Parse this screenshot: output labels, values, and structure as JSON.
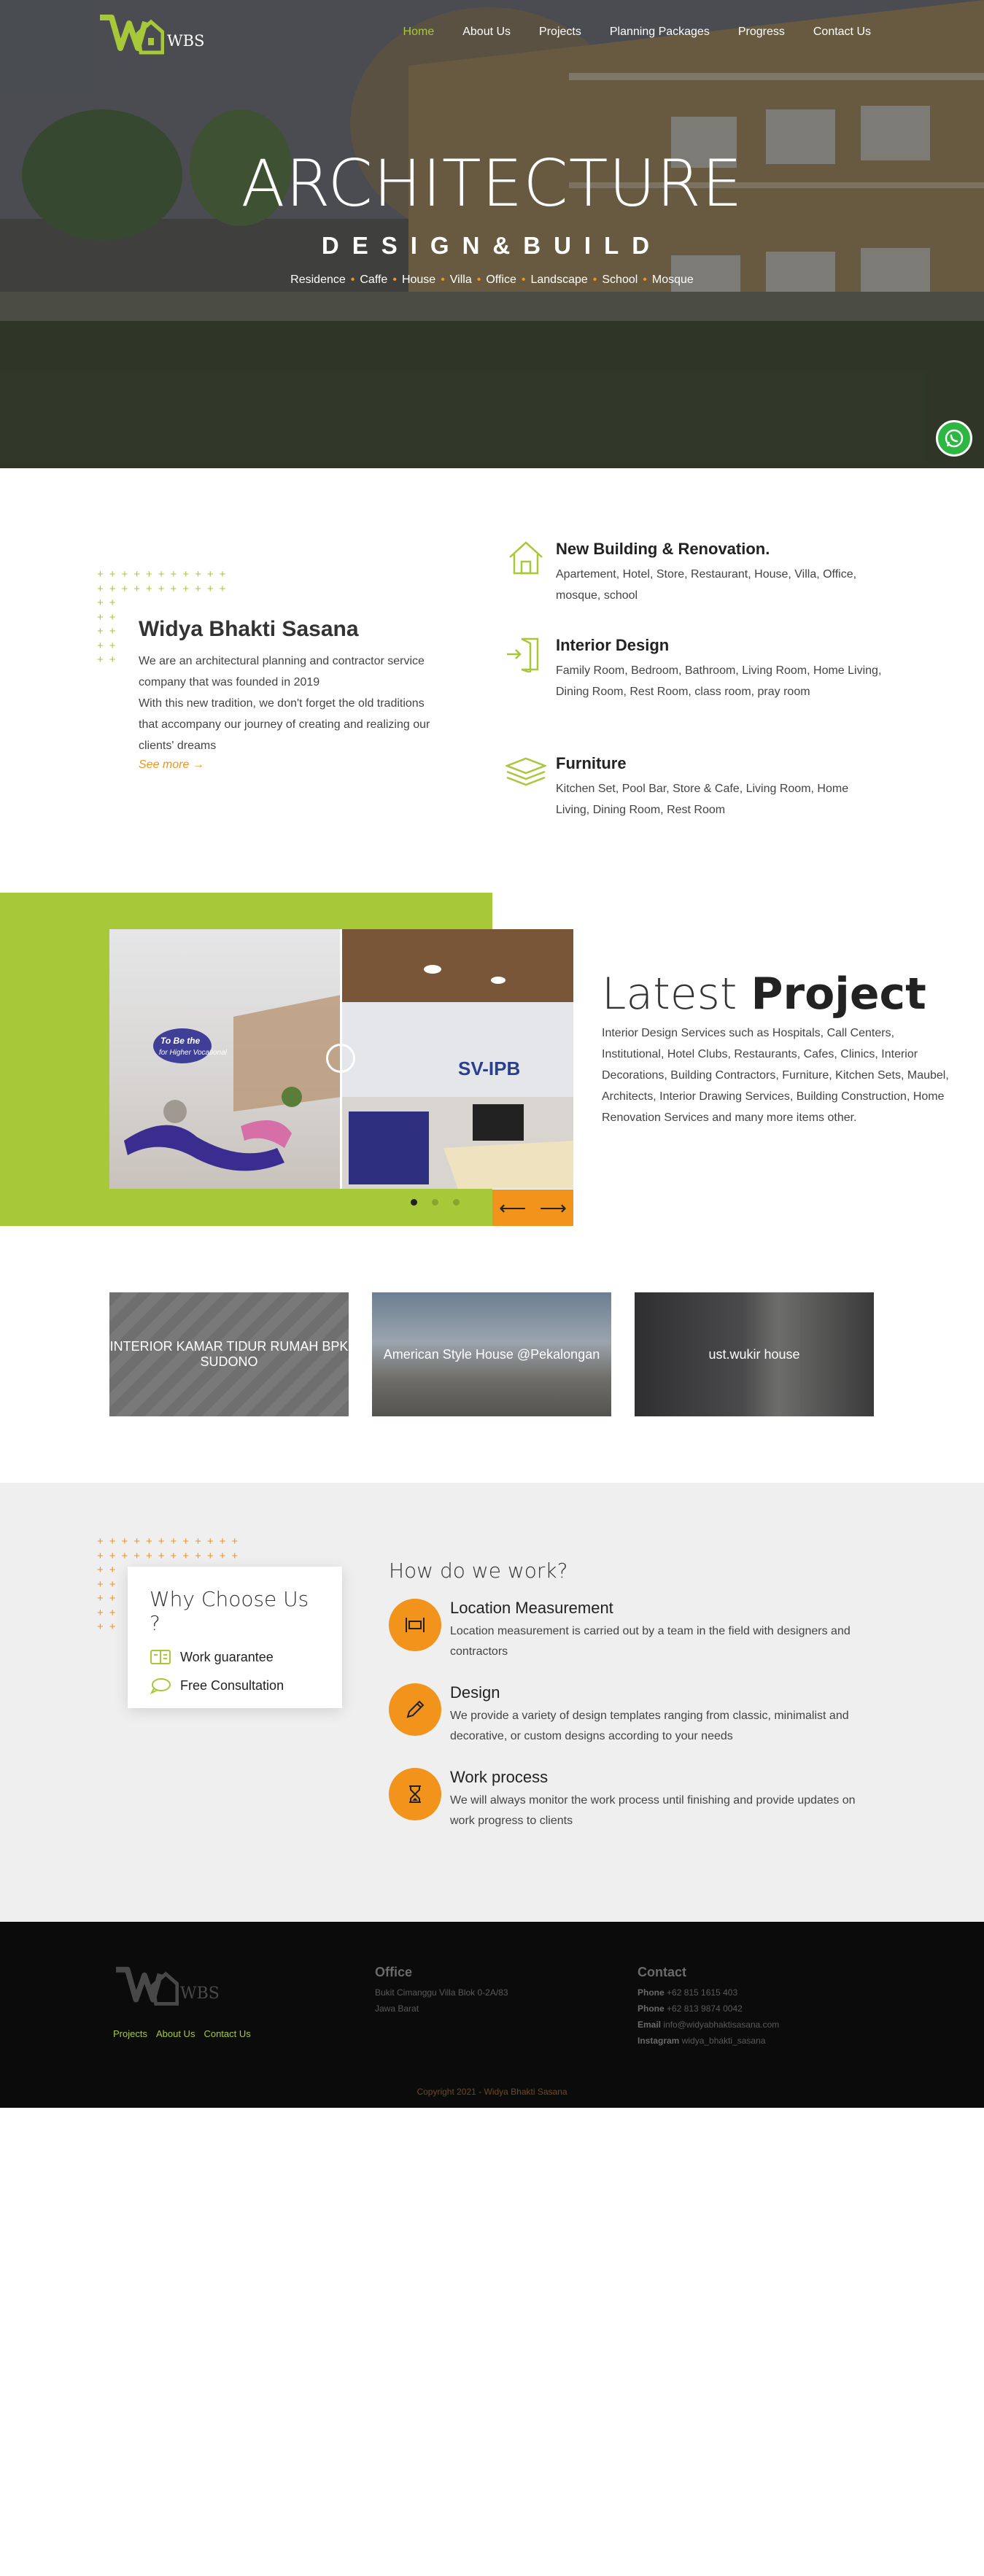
{
  "brand": {
    "name": "WBS",
    "colors": {
      "green": "#a6c839",
      "orange": "#f2931c"
    }
  },
  "nav": {
    "items": [
      {
        "label": "Home",
        "active": true
      },
      {
        "label": "About Us",
        "active": false
      },
      {
        "label": "Projects",
        "active": false
      },
      {
        "label": "Planning Packages",
        "active": false
      },
      {
        "label": "Progress",
        "active": false
      },
      {
        "label": "Contact Us",
        "active": false
      }
    ]
  },
  "hero": {
    "title": "ARCHITECTURE",
    "subtitle": "DESIGN&BUILD",
    "tags": [
      "Residence",
      "Caffe",
      "House",
      "Villa",
      "Office",
      "Landscape",
      "School",
      "Mosque"
    ],
    "whatsapp_icon": "whatsapp-icon"
  },
  "intro": {
    "title": "Widya Bhakti Sasana",
    "line1": "We are an architectural planning and contractor service company that was founded in 2019",
    "line2": "With this new tradition, we don't forget the old traditions that accompany our journey of creating and realizing our clients' dreams",
    "see_more": "See more"
  },
  "services": [
    {
      "icon": "house-icon",
      "title": "New Building & Renovation.",
      "desc": "Apartement, Hotel, Store, Restaurant, House, Villa, Office, mosque, school"
    },
    {
      "icon": "door-enter-icon",
      "title": "Interior Design",
      "desc": "Family Room, Bedroom, Bathroom, Living Room, Home Living, Dining Room, Rest Room, class room, pray room"
    },
    {
      "icon": "layers-icon",
      "title": "Furniture",
      "desc": "Kitchen Set, Pool Bar, Store & Cafe, Living Room, Home Living, Dining Room, Rest Room"
    }
  ],
  "latest": {
    "title_light": "Latest",
    "title_bold": "Project",
    "text": "Interior Design Services such as Hospitals, Call Centers, Institutional, Hotel Clubs, Restaurants, Cafes, Clinics, Interior Decorations, Building Contractors, Furniture, Kitchen Sets, Maubel, Architects, Interior Drawing Services, Building Construction, Home Renovation Services and many more items other.",
    "slider_left_caption": "To Be the Leading Choice for Higher Vocational Education",
    "slider_right_caption": "SV-IPB",
    "active_slide": 1,
    "slide_count": 3
  },
  "projects": [
    {
      "label": "INTERIOR KAMAR TIDUR RUMAH BPK SUDONO"
    },
    {
      "label": "American Style House @Pekalongan"
    },
    {
      "label": "ust.wukir house"
    }
  ],
  "why": {
    "title": "Why Choose Us ?",
    "items": [
      {
        "icon": "guarantee-icon",
        "label": "Work guarantee"
      },
      {
        "icon": "chat-icon",
        "label": "Free Consultation"
      }
    ]
  },
  "how": {
    "title": "How do we work?",
    "steps": [
      {
        "icon": "measure-icon",
        "title": "Location Measurement",
        "desc": "Location measurement is carried out by a team in the field with designers and contractors"
      },
      {
        "icon": "pencil-icon",
        "title": "Design",
        "desc": "We provide a variety of design templates ranging from classic, minimalist and decorative, or custom designs according to your needs"
      },
      {
        "icon": "hourglass-icon",
        "title": "Work process",
        "desc": "We will always monitor the work process until finishing and provide updates on work progress to clients"
      }
    ]
  },
  "footer": {
    "links": [
      "Projects",
      "About Us",
      "Contact Us"
    ],
    "office_title": "Office",
    "office_line1": "Bukit Cimanggu Villa Blok 0-2A/83",
    "office_line2": "Jawa Barat",
    "contact_title": "Contact",
    "phone_label": "Phone",
    "phone1": "+62 815 1615 403",
    "phone2": "+62 813 9874 0042",
    "email_label": "Email",
    "email": "info@widyabhaktisasana.com",
    "instagram_label": "Instagram",
    "instagram": "widya_bhakti_sasana",
    "copyright": "Copyright 2021 - Widya Bhakti Sasana"
  }
}
